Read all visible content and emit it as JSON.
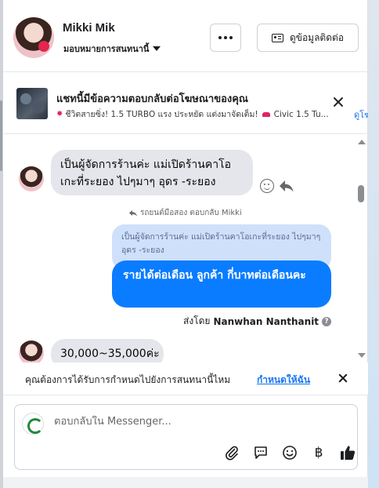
{
  "header": {
    "contact_name": "Mikki Mik",
    "assign_label": "มอบหมายการสนทนานี้",
    "contact_info_label": "ดูข้อมูลติดต่อ"
  },
  "ad": {
    "title": "แชทนี้มีข้อความตอบกลับต่อโฆษณาของคุณ",
    "subtitle": "ชีวิตสายซิ่ง! 1.5 TURBO แรง ประหยัด แต่งมาจัดเต็ม!",
    "subtitle_tail": "Civic 1.5 Tu...",
    "link_label": "ดูโฆ"
  },
  "conversation": {
    "incoming_1": "เป็นผู้จัดการร้านค่ะ แม่เปิดร้านคาโอเกะที่ระยอง ไปๆมาๆ อุดร -ระยอง",
    "reply_caption": "รถยนต์มือสอง ตอบกลับ Mikki",
    "quoted_text": "เป็นผู้จัดการร้านค่ะ แม่เปิดร้านคาโอเกะที่ระยอง ไปๆมาๆ อุดร -ระยอง",
    "outgoing_1": "รายได้ต่อเดือน ลูกค้า   กี่บาทต่อเดือนคะ",
    "sent_by_prefix": "ส่งโดย",
    "sent_by_name": "Nanwhan Nanthanit",
    "incoming_2": "30,000~35,000ค่ะ"
  },
  "suggestion": {
    "text": "คุณต้องการได้รับการกำหนดไปยังการสนทนานี้ไหม",
    "action_label": "กำหนดให้ฉัน"
  },
  "composer": {
    "placeholder": "ตอบกลับใน Messenger..."
  },
  "icons": {
    "more": "more-icon",
    "contact_card": "contact-card-icon",
    "attach": "paperclip-icon",
    "saved_replies": "chat-bubble-icon",
    "emoji": "emoji-icon",
    "payment": "baht-icon",
    "like": "thumbs-up-icon"
  },
  "colors": {
    "accent_blue": "#0a7cff",
    "link_blue": "#1876f2",
    "incoming_bubble": "#e4e6eb",
    "quoted_bubble": "#cfe0fb"
  }
}
